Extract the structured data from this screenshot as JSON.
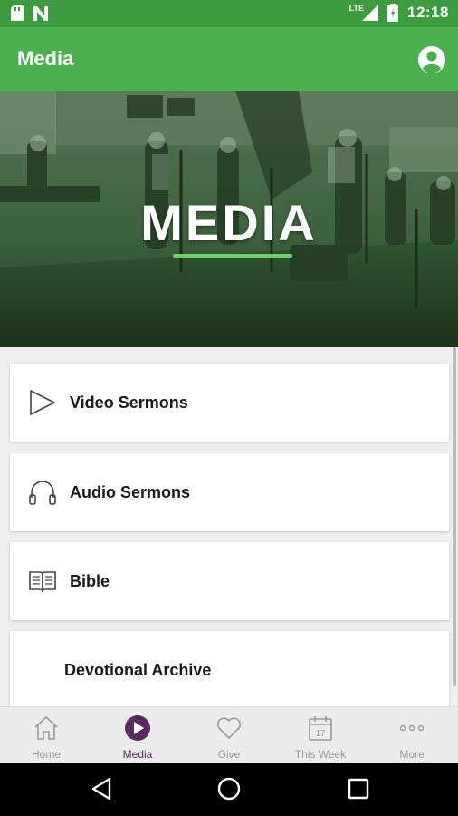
{
  "status_bar": {
    "time": "12:18",
    "network": "LTE",
    "icons": [
      "sd-card-icon",
      "n-notification-icon",
      "signal-icon",
      "battery-icon"
    ]
  },
  "app_bar": {
    "title": "Media",
    "profile_icon": "profile-icon"
  },
  "hero": {
    "title": "MEDIA",
    "accent_color": "#6bd16e"
  },
  "menu": [
    {
      "label": "Video Sermons",
      "icon": "play-icon"
    },
    {
      "label": "Audio Sermons",
      "icon": "headphones-icon"
    },
    {
      "label": "Bible",
      "icon": "book-icon"
    },
    {
      "label": "Devotional Archive",
      "icon": ""
    }
  ],
  "bottom_nav": {
    "items": [
      {
        "label": "Home",
        "icon": "home-icon",
        "active": false
      },
      {
        "label": "Media",
        "icon": "play-circle-icon",
        "active": true
      },
      {
        "label": "Give",
        "icon": "heart-icon",
        "active": false
      },
      {
        "label": "This Week",
        "icon": "calendar-icon",
        "calendar_day": "17",
        "active": false
      },
      {
        "label": "More",
        "icon": "more-icon",
        "active": false
      }
    ],
    "active_color": "#5a2a5e"
  },
  "colors": {
    "status_bar": "#3c9a3f",
    "app_bar": "#4caf50",
    "background": "#efefef"
  }
}
